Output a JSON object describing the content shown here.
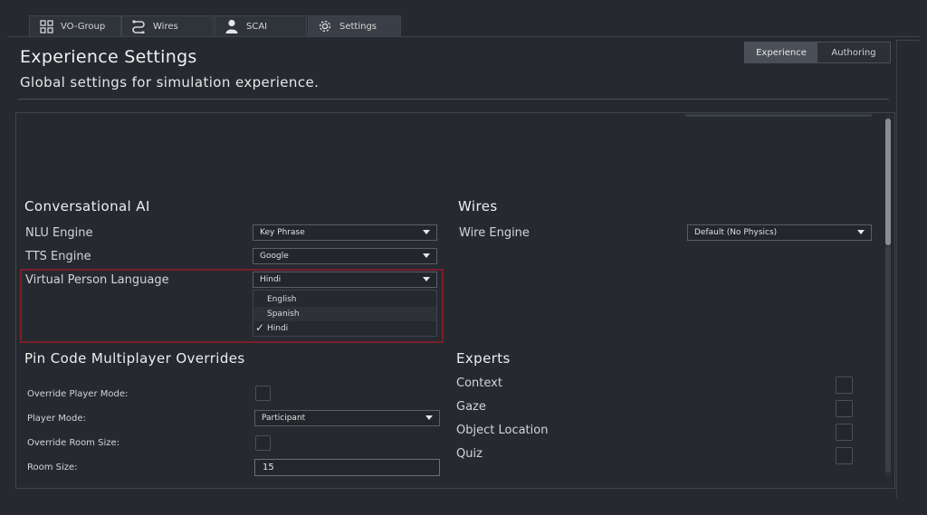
{
  "tabs": [
    {
      "label": "VO-Group",
      "icon": "group-icon"
    },
    {
      "label": "Wires",
      "icon": "wires-icon"
    },
    {
      "label": "SCAI",
      "icon": "person-icon"
    },
    {
      "label": "Settings",
      "icon": "gear-icon",
      "active": true
    }
  ],
  "header": {
    "title": "Experience Settings",
    "subtitle": "Global settings for simulation experience."
  },
  "mode_toggle": {
    "experience": "Experience",
    "authoring": "Authoring",
    "selected": "Experience"
  },
  "conversational_ai": {
    "title": "Conversational AI",
    "nlu_label": "NLU Engine",
    "nlu_value": "Key Phrase",
    "tts_label": "TTS Engine",
    "tts_value": "Google",
    "language_label": "Virtual Person Language",
    "language_value": "Hindi",
    "language_options": [
      "English",
      "Spanish",
      "Hindi"
    ],
    "check_mark": "✓"
  },
  "wires": {
    "title": "Wires",
    "engine_label": "Wire Engine",
    "engine_value": "Default (No Physics)"
  },
  "pin_code": {
    "title": "Pin Code Multiplayer Overrides",
    "override_player_mode_label": "Override Player Mode:",
    "player_mode_label": "Player Mode:",
    "player_mode_value": "Participant",
    "override_room_size_label": "Override Room Size:",
    "room_size_label": "Room Size:",
    "room_size_value": "15"
  },
  "experts": {
    "title": "Experts",
    "items": [
      "Context",
      "Gaze",
      "Object Location",
      "Quiz"
    ]
  },
  "colors": {
    "background": "#262a30",
    "highlight": "#7a1f2b",
    "active_toggle": "#4a4f57"
  }
}
